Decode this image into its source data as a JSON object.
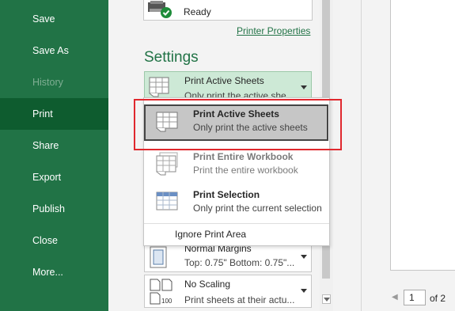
{
  "nav": {
    "items": [
      {
        "label": "Save"
      },
      {
        "label": "Save As"
      },
      {
        "label": "History"
      },
      {
        "label": "Print"
      },
      {
        "label": "Share"
      },
      {
        "label": "Export"
      },
      {
        "label": "Publish"
      },
      {
        "label": "Close"
      },
      {
        "label": "More..."
      }
    ]
  },
  "printer": {
    "status": "Ready",
    "properties_link": "Printer Properties"
  },
  "settings": {
    "heading": "Settings",
    "active_option": {
      "title": "Print Active Sheets",
      "subtitle": "Only print the active she..."
    },
    "margins": {
      "title": "Normal Margins",
      "subtitle": "Top: 0.75\" Bottom: 0.75\"..."
    },
    "scaling": {
      "title": "No Scaling",
      "subtitle": "Print sheets at their actu..."
    }
  },
  "menu": {
    "items": [
      {
        "title": "Print Active Sheets",
        "subtitle": "Only print the active sheets"
      },
      {
        "title": "Print Entire Workbook",
        "subtitle": "Print the entire workbook"
      },
      {
        "title": "Print Selection",
        "subtitle": "Only print the current selection"
      }
    ],
    "ignore_print_area": "Ignore Print Area"
  },
  "pager": {
    "current": "1",
    "total_label": "of 2"
  },
  "colors": {
    "nav_bg": "#217346",
    "nav_active": "#0e5c2f",
    "accent": "#217346",
    "highlight_border": "#e0282e"
  }
}
